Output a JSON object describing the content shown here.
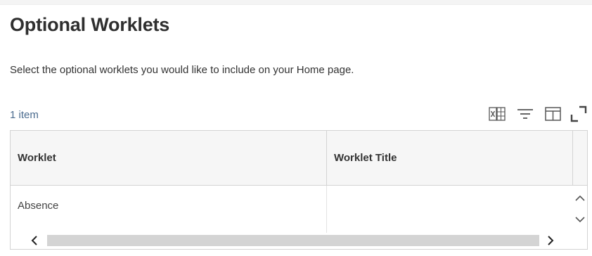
{
  "page": {
    "title": "Optional Worklets",
    "description": "Select the optional worklets you would like to include on your Home page."
  },
  "grid": {
    "item_count": "1 item",
    "toolbar": {
      "icons": [
        "export-to-excel-icon",
        "filter-icon",
        "view-columns-icon",
        "fullscreen-icon"
      ]
    },
    "columns": [
      "Worklet",
      "Worklet Title"
    ],
    "rows": [
      {
        "worklet": "Absence",
        "worklet_title": ""
      }
    ]
  },
  "colors": {
    "title_text": "#2f2f2f",
    "count_link": "#4a6b8e",
    "header_bg": "#f6f6f6",
    "border": "#d3d3d3",
    "scrollbar": "#d4d4d4",
    "icon_gray": "#555555"
  }
}
